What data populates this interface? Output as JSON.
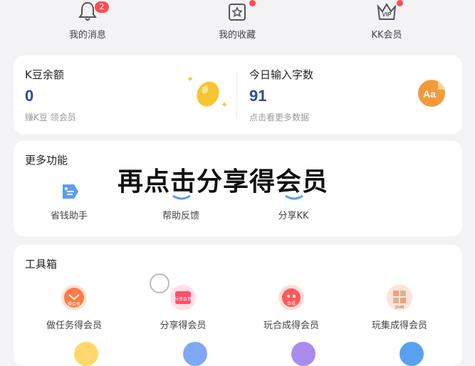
{
  "top_nav": [
    {
      "label": "我的消息",
      "icon": "bell-icon",
      "badge": "2"
    },
    {
      "label": "我的收藏",
      "icon": "folder-star-icon",
      "dot": true
    },
    {
      "label": "KK会员",
      "icon": "vip-crown-icon",
      "icon_text": "VIP",
      "dot": true
    }
  ],
  "stats": {
    "kdou": {
      "title": "K豆余额",
      "value": "0",
      "sub": "赚K豆 领会员"
    },
    "input": {
      "title": "今日输入字数",
      "value": "91",
      "sub": "点击看更多数据",
      "icon_text": "Aa"
    }
  },
  "more": {
    "title": "更多功能",
    "items": [
      {
        "label": "省钱助手",
        "icon": "coupon-tag-icon"
      },
      {
        "label": "帮助反馈",
        "icon": "feedback-icon"
      },
      {
        "label": "分享KK",
        "icon": "share-icon"
      }
    ]
  },
  "toolbox": {
    "title": "工具箱",
    "items": [
      {
        "label": "做任务得会员",
        "icon": "task-reward-icon",
        "icon_text": "得会员",
        "color": "#ff7a45"
      },
      {
        "label": "分享得会员",
        "icon": "share-reward-icon",
        "icon_text": "分享会员",
        "color": "#ff4d6d"
      },
      {
        "label": "玩合成得会员",
        "icon": "merge-game-icon",
        "icon_text": "合成",
        "color": "#ff5a5a"
      },
      {
        "label": "玩集成得会员",
        "icon": "collect-game-icon",
        "icon_text": "2048",
        "color": "#f0a080"
      }
    ]
  },
  "overlay_caption": "再点击分享得会员",
  "colors": {
    "accent": "#2d4a9c",
    "badge": "#ff4d4f",
    "bg": "#f3f3f6"
  }
}
